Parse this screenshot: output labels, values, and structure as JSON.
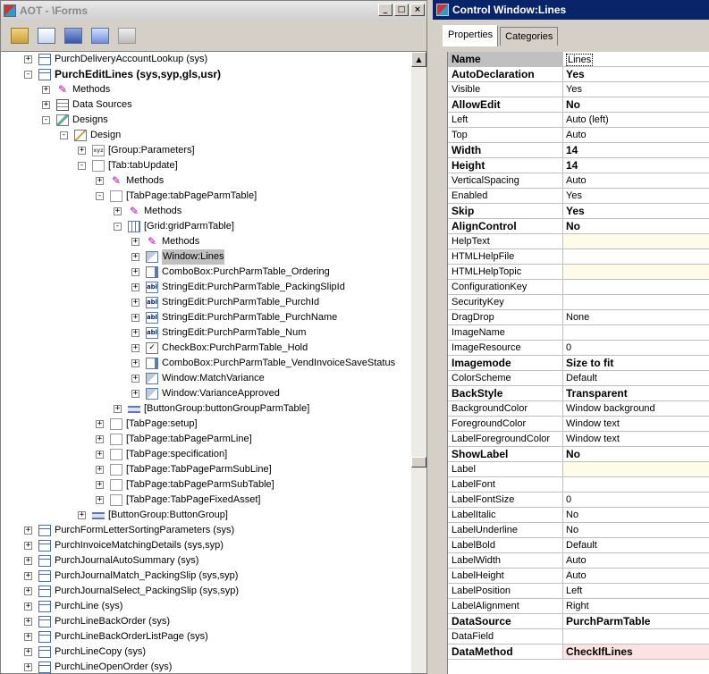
{
  "aot": {
    "title": "AOT - \\Forms",
    "toolbar": [
      "open-icon",
      "properties-icon",
      "save-all-icon",
      "import-icon",
      "export-icon"
    ],
    "tree": [
      {
        "label": "PurchDeliveryAccountLookup (sys)",
        "icon": "form",
        "exp": "+",
        "depth": 0,
        "bold": false
      },
      {
        "label": "PurchEditLines (sys,syp,gls,usr)",
        "icon": "form",
        "exp": "-",
        "depth": 0,
        "bold": true
      },
      {
        "label": "Methods",
        "icon": "methods",
        "exp": "+",
        "depth": 1
      },
      {
        "label": "Data Sources",
        "icon": "ds",
        "exp": "+",
        "depth": 1
      },
      {
        "label": "Designs",
        "icon": "designs",
        "exp": "-",
        "depth": 1
      },
      {
        "label": "Design",
        "icon": "design",
        "exp": "-",
        "depth": 2
      },
      {
        "label": "[Group:Parameters]",
        "icon": "group",
        "exp": "+",
        "depth": 3
      },
      {
        "label": "[Tab:tabUpdate]",
        "icon": "folder",
        "exp": "-",
        "depth": 3
      },
      {
        "label": "Methods",
        "icon": "methods",
        "exp": "+",
        "depth": 4
      },
      {
        "label": "[TabPage:tabPageParmTable]",
        "icon": "folder",
        "exp": "-",
        "depth": 4
      },
      {
        "label": "Methods",
        "icon": "methods",
        "exp": "+",
        "depth": 5
      },
      {
        "label": "[Grid:gridParmTable]",
        "icon": "grid",
        "exp": "-",
        "depth": 5
      },
      {
        "label": "Methods",
        "icon": "methods",
        "exp": "+",
        "depth": 6
      },
      {
        "label": "Window:Lines",
        "icon": "window",
        "exp": "+",
        "depth": 6,
        "selected": true
      },
      {
        "label": "ComboBox:PurchParmTable_Ordering",
        "icon": "combo",
        "exp": "+",
        "depth": 6
      },
      {
        "label": "StringEdit:PurchParmTable_PackingSlipId",
        "icon": "abl",
        "exp": "+",
        "depth": 6
      },
      {
        "label": "StringEdit:PurchParmTable_PurchId",
        "icon": "abl",
        "exp": "+",
        "depth": 6
      },
      {
        "label": "StringEdit:PurchParmTable_PurchName",
        "icon": "abl",
        "exp": "+",
        "depth": 6
      },
      {
        "label": "StringEdit:PurchParmTable_Num",
        "icon": "abl",
        "exp": "+",
        "depth": 6
      },
      {
        "label": "CheckBox:PurchParmTable_Hold",
        "icon": "check",
        "exp": "+",
        "depth": 6
      },
      {
        "label": "ComboBox:PurchParmTable_VendInvoiceSaveStatus",
        "icon": "combo",
        "exp": "+",
        "depth": 6
      },
      {
        "label": "Window:MatchVariance",
        "icon": "window",
        "exp": "+",
        "depth": 6
      },
      {
        "label": "Window:VarianceApproved",
        "icon": "window",
        "exp": "+",
        "depth": 6
      },
      {
        "label": "[ButtonGroup:buttonGroupParmTable]",
        "icon": "btngrp",
        "exp": "+",
        "depth": 5
      },
      {
        "label": "[TabPage:setup]",
        "icon": "folder",
        "exp": "+",
        "depth": 4
      },
      {
        "label": "[TabPage:tabPageParmLine]",
        "icon": "folder",
        "exp": "+",
        "depth": 4
      },
      {
        "label": "[TabPage:specification]",
        "icon": "folder",
        "exp": "+",
        "depth": 4
      },
      {
        "label": "[TabPage:TabPageParmSubLine]",
        "icon": "folder",
        "exp": "+",
        "depth": 4
      },
      {
        "label": "[TabPage:tabPageParmSubTable]",
        "icon": "folder",
        "exp": "+",
        "depth": 4
      },
      {
        "label": "[TabPage:TabPageFixedAsset]",
        "icon": "folder",
        "exp": "+",
        "depth": 4
      },
      {
        "label": "[ButtonGroup:ButtonGroup]",
        "icon": "btngrp",
        "exp": "+",
        "depth": 3
      },
      {
        "label": "PurchFormLetterSortingParameters (sys)",
        "icon": "form",
        "exp": "+",
        "depth": 0
      },
      {
        "label": "PurchInvoiceMatchingDetails (sys,syp)",
        "icon": "form",
        "exp": "+",
        "depth": 0
      },
      {
        "label": "PurchJournalAutoSummary (sys)",
        "icon": "form",
        "exp": "+",
        "depth": 0
      },
      {
        "label": "PurchJournalMatch_PackingSlip (sys,syp)",
        "icon": "form",
        "exp": "+",
        "depth": 0
      },
      {
        "label": "PurchJournalSelect_PackingSlip (sys,syp)",
        "icon": "form",
        "exp": "+",
        "depth": 0
      },
      {
        "label": "PurchLine (sys)",
        "icon": "form",
        "exp": "+",
        "depth": 0
      },
      {
        "label": "PurchLineBackOrder (sys)",
        "icon": "form",
        "exp": "+",
        "depth": 0
      },
      {
        "label": "PurchLineBackOrderListPage (sys)",
        "icon": "form",
        "exp": "+",
        "depth": 0
      },
      {
        "label": "PurchLineCopy (sys)",
        "icon": "form",
        "exp": "+",
        "depth": 0
      },
      {
        "label": "PurchLineOpenOrder (sys)",
        "icon": "form",
        "exp": "+",
        "depth": 0
      }
    ]
  },
  "control": {
    "title": "Control Window:Lines",
    "tabs": [
      "Properties",
      "Categories"
    ],
    "properties": [
      {
        "name": "Name",
        "value": "Lines",
        "bold": true,
        "header": true
      },
      {
        "name": "AutoDeclaration",
        "value": "Yes",
        "bold": true
      },
      {
        "name": "Visible",
        "value": "Yes"
      },
      {
        "name": "AllowEdit",
        "value": "No",
        "bold": true
      },
      {
        "name": "Left",
        "value": "Auto (left)"
      },
      {
        "name": "Top",
        "value": "Auto"
      },
      {
        "name": "Width",
        "value": "14",
        "bold": true
      },
      {
        "name": "Height",
        "value": "14",
        "bold": true
      },
      {
        "name": "VerticalSpacing",
        "value": "Auto"
      },
      {
        "name": "Enabled",
        "value": "Yes"
      },
      {
        "name": "Skip",
        "value": "Yes",
        "bold": true
      },
      {
        "name": "AlignControl",
        "value": "No",
        "bold": true
      },
      {
        "name": "HelpText",
        "value": "",
        "help": true
      },
      {
        "name": "HTMLHelpFile",
        "value": ""
      },
      {
        "name": "HTMLHelpTopic",
        "value": "",
        "help": true
      },
      {
        "name": "ConfigurationKey",
        "value": ""
      },
      {
        "name": "SecurityKey",
        "value": ""
      },
      {
        "name": "DragDrop",
        "value": "None"
      },
      {
        "name": "ImageName",
        "value": ""
      },
      {
        "name": "ImageResource",
        "value": "0"
      },
      {
        "name": "Imagemode",
        "value": "Size to fit",
        "bold": true
      },
      {
        "name": "ColorScheme",
        "value": "Default"
      },
      {
        "name": "BackStyle",
        "value": "Transparent",
        "bold": true
      },
      {
        "name": "BackgroundColor",
        "value": "Window background"
      },
      {
        "name": "ForegroundColor",
        "value": "Window text"
      },
      {
        "name": "LabelForegroundColor",
        "value": "Window text"
      },
      {
        "name": "ShowLabel",
        "value": "No",
        "bold": true
      },
      {
        "name": "Label",
        "value": "",
        "help": true
      },
      {
        "name": "LabelFont",
        "value": ""
      },
      {
        "name": "LabelFontSize",
        "value": "0"
      },
      {
        "name": "LabelItalic",
        "value": "No"
      },
      {
        "name": "LabelUnderline",
        "value": "No"
      },
      {
        "name": "LabelBold",
        "value": "Default"
      },
      {
        "name": "LabelWidth",
        "value": "Auto"
      },
      {
        "name": "LabelHeight",
        "value": "Auto"
      },
      {
        "name": "LabelPosition",
        "value": "Left"
      },
      {
        "name": "LabelAlignment",
        "value": "Right"
      },
      {
        "name": "DataSource",
        "value": "PurchParmTable",
        "bold": true
      },
      {
        "name": "DataField",
        "value": ""
      },
      {
        "name": "DataMethod",
        "value": "CheckIfLines",
        "bold": true,
        "pink": true
      }
    ]
  }
}
